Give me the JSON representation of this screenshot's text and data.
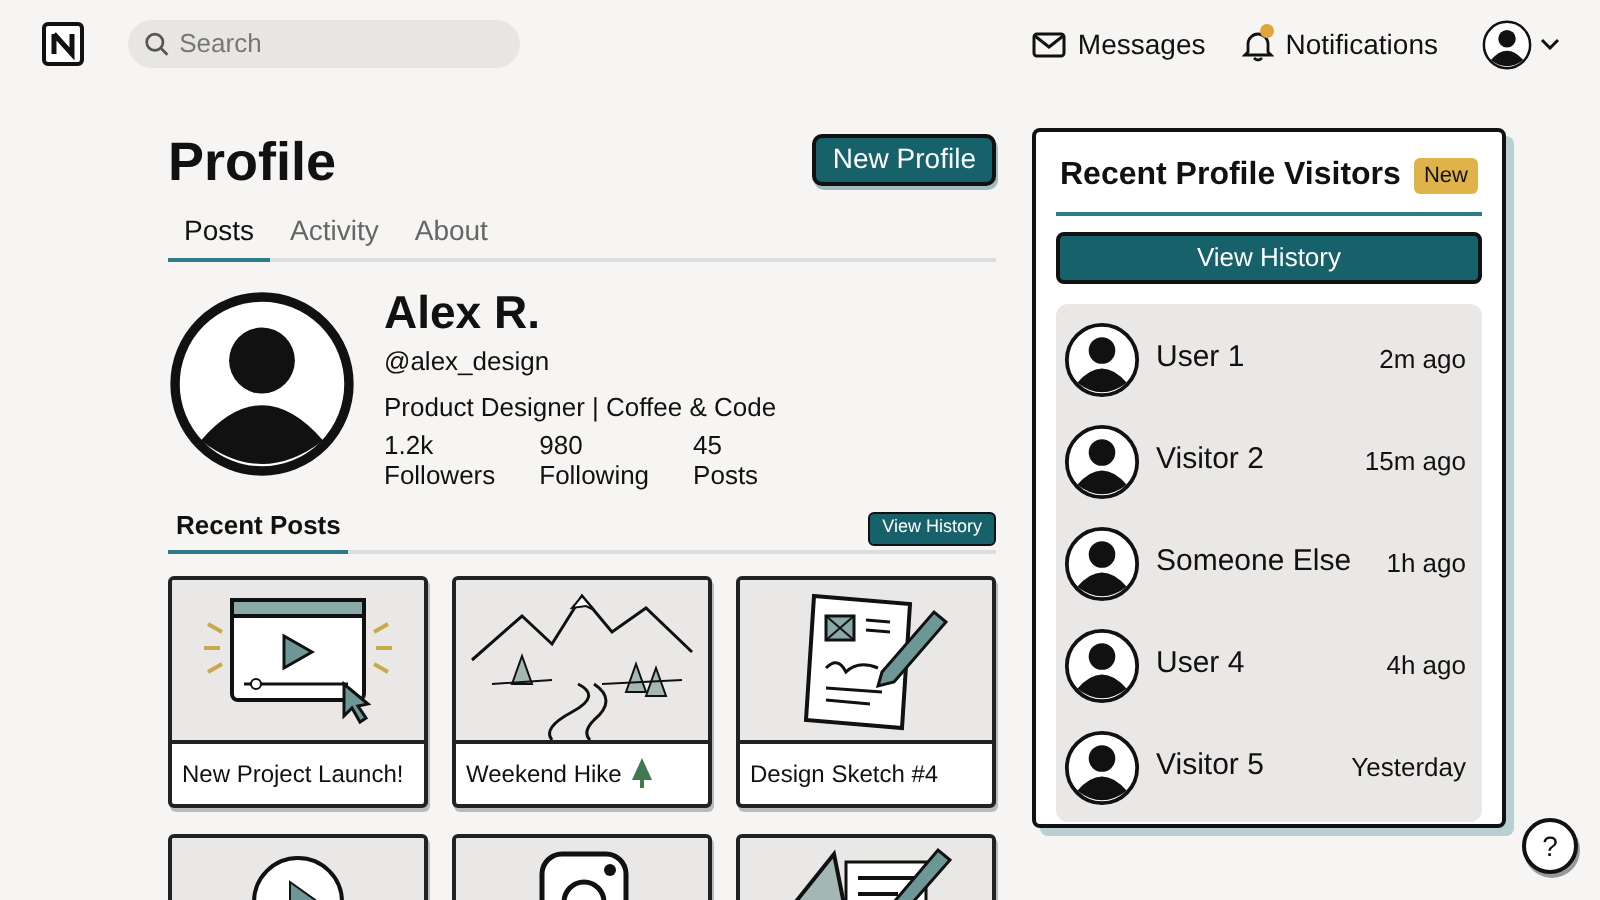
{
  "topbar": {
    "search": {
      "placeholder": "Search"
    },
    "messages": "Messages",
    "notifications": {
      "label": "Notifications",
      "unread": true
    }
  },
  "profile": {
    "title": "Profile",
    "new_button": "New Profile",
    "tabs": [
      {
        "label": "Posts",
        "selected": true
      },
      {
        "label": "Activity",
        "selected": false
      },
      {
        "label": "About",
        "selected": false
      }
    ],
    "name": "Alex R.",
    "handle": "@alex_design",
    "bio": "Product Designer | Coffee & Code",
    "stats": [
      {
        "value": "1.2k",
        "label": "Followers"
      },
      {
        "value": "980",
        "label": "Following"
      },
      {
        "value": "45",
        "label": "Posts"
      }
    ],
    "recent_posts": {
      "title": "Recent Posts",
      "button": "View History",
      "posts": [
        {
          "kind": "video",
          "caption": "New Project Launch!"
        },
        {
          "kind": "hike",
          "caption": "Weekend Hike"
        },
        {
          "kind": "sketch",
          "caption": "Design Sketch #4"
        },
        {
          "kind": "play"
        },
        {
          "kind": "camera"
        },
        {
          "kind": "drafting"
        }
      ]
    }
  },
  "visitors": {
    "title": "Recent Profile Visitors",
    "badge": "New",
    "button": "View History",
    "items": [
      {
        "name": "User 1",
        "time": "2m ago"
      },
      {
        "name": "Visitor 2",
        "time": "15m ago"
      },
      {
        "name": "Someone Else",
        "time": "1h ago"
      },
      {
        "name": "User 4",
        "time": "4h ago"
      },
      {
        "name": "Visitor 5",
        "time": "Yesterday"
      }
    ]
  },
  "help": "?"
}
